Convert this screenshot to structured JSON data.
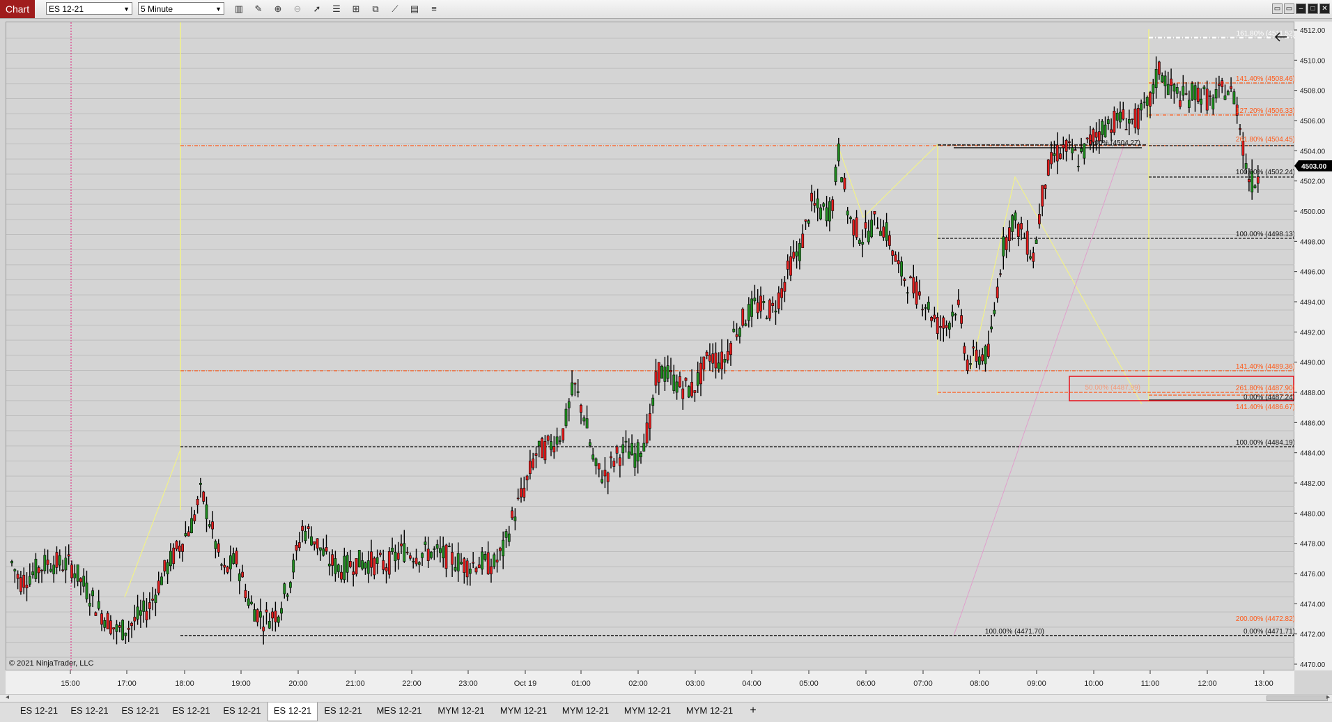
{
  "window": {
    "chart_tab_label": "Chart",
    "instrument": "ES 12-21",
    "interval": "5 Minute"
  },
  "toolbar_icons": [
    "bar-type-icon",
    "pencil-draw-icon",
    "zoom-in-icon",
    "zoom-out-icon",
    "pointer-icon",
    "properties-icon",
    "indicators-icon",
    "strategies-icon",
    "drawing-tools-icon",
    "data-box-icon",
    "list-icon"
  ],
  "copyright": "© 2021 NinjaTrader, LLC",
  "price_axis": {
    "labels": [
      "4512.00",
      "4510.00",
      "4508.00",
      "4506.00",
      "4504.00",
      "4502.00",
      "4500.00",
      "4498.00",
      "4496.00",
      "4494.00",
      "4492.00",
      "4490.00",
      "4488.00",
      "4486.00",
      "4484.00",
      "4482.00",
      "4480.00",
      "4478.00",
      "4476.00",
      "4474.00",
      "4472.00",
      "4470.00"
    ],
    "current_price": "4503.00"
  },
  "time_axis": {
    "labels": [
      "15:00",
      "17:00",
      "18:00",
      "19:00",
      "20:00",
      "21:00",
      "22:00",
      "23:00",
      "Oct 19",
      "01:00",
      "02:00",
      "03:00",
      "04:00",
      "05:00",
      "06:00",
      "07:00",
      "08:00",
      "09:00",
      "10:00",
      "11:00",
      "12:00",
      "13:00"
    ]
  },
  "fib_labels": {
    "a": "161.80% (4511.52)",
    "b": "141.40% (4508.46)",
    "c": "127.20% (4506.33)",
    "d": "261.80% (4504.45)",
    "e": "0.00% (4504.27)",
    "f": "100.00% (4502.24)",
    "g": "100.00% (4498.13)",
    "h": "141.40% (4489.36)",
    "i": "50.00% (4487.99)",
    "j": "261.80% (4487.90)",
    "k": "0.00% (4487.24)",
    "l": "141.40% (4486.67)",
    "m": "100.00% (4484.19)",
    "n": "200.00% (4472.82)",
    "o": "100.00% (4471.70)",
    "p": "0.00% (4471.71)"
  },
  "colors": {
    "up_candle": "#1e8c1e",
    "down_candle": "#e21b1b",
    "fib_orange": "#ff5a1a",
    "fib_black": "#111111",
    "zigzag_yellow": "#f1f18a",
    "session_break": "#e0207a",
    "price_marker_bg": "#000000"
  },
  "bottom_tabs": [
    "ES 12-21",
    "ES 12-21",
    "ES 12-21",
    "ES 12-21",
    "ES 12-21",
    "ES 12-21",
    "ES 12-21",
    "MES 12-21",
    "MYM 12-21",
    "MYM 12-21",
    "MYM 12-21",
    "MYM 12-21",
    "MYM 12-21"
  ],
  "active_tab_index": 5,
  "add_tab_label": "+"
}
